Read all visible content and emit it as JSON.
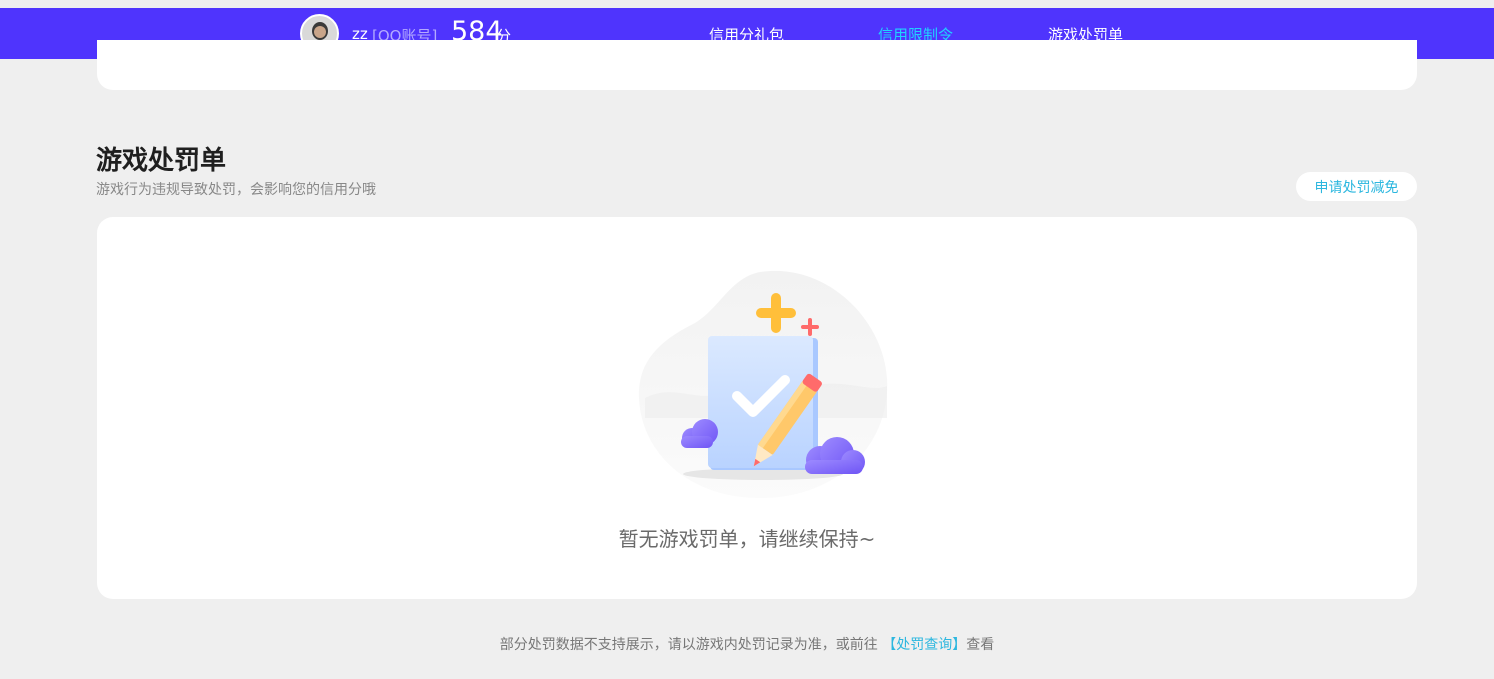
{
  "header": {
    "username": "zz",
    "account_type": "[QQ账号]",
    "score": "584",
    "score_unit": "分",
    "nav": [
      {
        "label": "信用分礼包",
        "active": false
      },
      {
        "label": "信用限制令",
        "active": true
      },
      {
        "label": "游戏处罚单",
        "active": false
      }
    ],
    "accent_color": "#4f34fd",
    "active_color": "#1fd3ff"
  },
  "section": {
    "title": "游戏处罚单",
    "subtitle": "游戏行为违规导致处罚，会影响您的信用分哦",
    "appeal_button": "申请处罚减免"
  },
  "empty_state": {
    "icon": "clipboard-check-pencil-illustration",
    "message": "暂无游戏罚单，请继续保持~"
  },
  "footer": {
    "text_before": "部分处罚数据不支持展示，请以游戏内处罚记录为准，或前往",
    "link": "【处罚查询】",
    "text_after": "查看"
  }
}
